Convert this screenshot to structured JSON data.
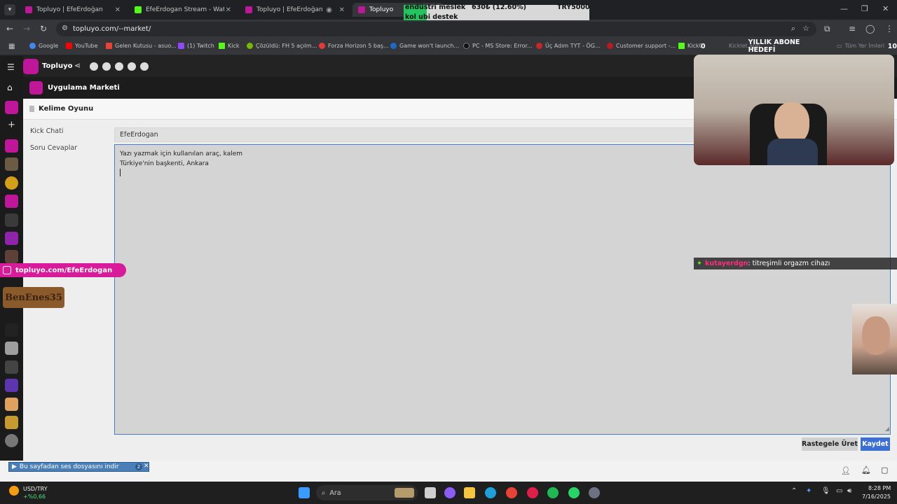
{
  "tabs": [
    {
      "label": "Topluyo | EfeErdoğan",
      "color": "#c0179a"
    },
    {
      "label": "EfeErdogan Stream - Watch Liv",
      "color": "#53fc18"
    },
    {
      "label": "Topluyo | EfeErdoğan",
      "color": "#c0179a"
    },
    {
      "label": "Topluyo",
      "color": "#c0179a"
    }
  ],
  "address": {
    "url": "topluyo.com/--market/"
  },
  "bookmarks": [
    {
      "label": "Google",
      "color": "#4285f4"
    },
    {
      "label": "YouTube",
      "color": "#ff0000"
    },
    {
      "label": "Gelen Kutusu - asuo...",
      "color": "#ea4335"
    },
    {
      "label": "(1) Twitch",
      "color": "#9146ff"
    },
    {
      "label": "Kick",
      "color": "#53fc18"
    },
    {
      "label": "Çözüldü: FH 5 açılm...",
      "color": "#76b900"
    },
    {
      "label": "Forza Horizon 5 baş...",
      "color": "#e53935"
    },
    {
      "label": "Game won't launch...",
      "color": "#1b6ac9"
    },
    {
      "label": "PC - MS Store: Error...",
      "color": "#111111"
    },
    {
      "label": "Üç Adım TYT - ÖG...",
      "color": "#c62828"
    },
    {
      "label": "Customer support -...",
      "color": "#b71c1c"
    },
    {
      "label": "KickClip",
      "color": "#53fc18"
    },
    {
      "label": "Kicklet.app",
      "color": "#555555"
    },
    {
      "label": "Tüm Yer İmleri",
      "color": "#888888"
    }
  ],
  "app": {
    "brand": "Topluyo",
    "market_title": "Uygulama Marketi",
    "panel_title": "Kelime Oyunu",
    "kick_label": "Kick Chati",
    "kick_value": "EfeErdogan",
    "qa_label": "Soru Cevaplar",
    "qa_lines": [
      "Yazı yazmak için kullanılan araç, kalem",
      "Türkiye'nin başkenti, Ankara"
    ],
    "random_button": "Rastegele Üret",
    "save_button": "Kaydet"
  },
  "overlays": {
    "goal_count": "0",
    "goal_label": "YILLIK ABONE HEDEFİ",
    "goal_target": "10",
    "donation_line1": "endüstri meslek",
    "donation_line2": "kol ubi destek",
    "donation_amount": "630₺ (12.60%)",
    "donation_target": "TRY5000",
    "chat_user": "kutayerdgn",
    "chat_text": ": titreşimli orgazm cihazı",
    "link": "topluyo.com/EfeErdogan",
    "benenes": "BenEnes35"
  },
  "statusbar": {
    "ses_text": "Bu sayfadan ses dosyasını indir",
    "badge": "2"
  },
  "taskbar": {
    "search": "Ara",
    "ticker_name": "USD/TRY",
    "ticker_change": "+%0,66",
    "time": "8:28 PM",
    "date": "7/16/2025"
  },
  "colors": {
    "accent": "#d81b9a",
    "focus_border": "#4a7bd3",
    "save_blue": "#3b6fd6"
  }
}
